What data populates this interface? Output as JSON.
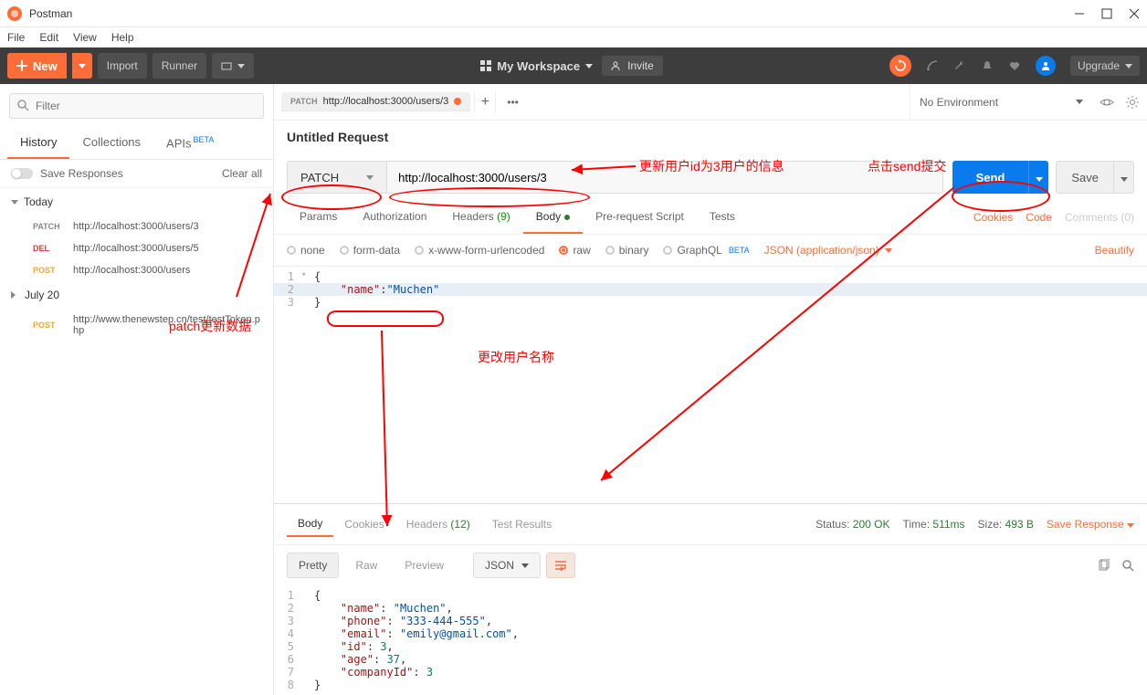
{
  "app": {
    "title": "Postman"
  },
  "menu": [
    "File",
    "Edit",
    "View",
    "Help"
  ],
  "topbar": {
    "new_label": "New",
    "import_label": "Import",
    "runner_label": "Runner",
    "workspace_label": "My Workspace",
    "invite_label": "Invite",
    "upgrade_label": "Upgrade"
  },
  "sidebar": {
    "filter_placeholder": "Filter",
    "tabs": {
      "history": "History",
      "collections": "Collections",
      "apis": "APIs",
      "beta": "BETA"
    },
    "save_responses": "Save Responses",
    "clear_all": "Clear all",
    "groups": [
      {
        "label": "Today",
        "items": [
          {
            "method": "PATCH",
            "cls": "m-patch",
            "url": "http://localhost:3000/users/3"
          },
          {
            "method": "DEL",
            "cls": "m-del",
            "url": "http://localhost:3000/users/5"
          },
          {
            "method": "POST",
            "cls": "m-post",
            "url": "http://localhost:3000/users"
          }
        ]
      },
      {
        "label": "July 20",
        "items": [
          {
            "method": "POST",
            "cls": "m-post",
            "url": "http://www.thenewstep.cn/test/testToken.php"
          }
        ]
      }
    ]
  },
  "annotations": {
    "patch_update": "patch更新数据",
    "update_info": "更新用户id为3用户的信息",
    "click_send": "点击send提交",
    "change_name": "更改用户名称"
  },
  "env": {
    "no_env": "No Environment"
  },
  "tab": {
    "method": "PATCH",
    "url": "http://localhost:3000/users/3"
  },
  "request": {
    "title": "Untitled Request",
    "method": "PATCH",
    "url": "http://localhost:3000/users/3",
    "send": "Send",
    "save": "Save",
    "subtabs": {
      "params": "Params",
      "auth": "Authorization",
      "headers": "Headers",
      "headers_count": "(9)",
      "body": "Body",
      "prereq": "Pre-request Script",
      "tests": "Tests"
    },
    "links": {
      "cookies": "Cookies",
      "code": "Code",
      "comments": "Comments (0)"
    },
    "body_types": {
      "none": "none",
      "formdata": "form-data",
      "urlenc": "x-www-form-urlencoded",
      "raw": "raw",
      "binary": "binary",
      "graphql": "GraphQL",
      "beta": "BETA"
    },
    "content_type": "JSON (application/json)",
    "beautify": "Beautify",
    "body_lines": [
      {
        "n": "1",
        "text": "{",
        "arrow": "▾"
      },
      {
        "n": "2",
        "key": "\"name\"",
        "val": "\"Muchen\""
      },
      {
        "n": "3",
        "text": "}"
      }
    ]
  },
  "response": {
    "tabs": {
      "body": "Body",
      "cookies": "Cookies",
      "headers": "Headers",
      "headers_count": "(12)",
      "tests": "Test Results"
    },
    "status": {
      "label": "Status:",
      "value": "200 OK"
    },
    "time": {
      "label": "Time:",
      "value": "511ms"
    },
    "size": {
      "label": "Size:",
      "value": "493 B"
    },
    "save_response": "Save Response",
    "toolbar": {
      "pretty": "Pretty",
      "raw": "Raw",
      "preview": "Preview",
      "json": "JSON"
    },
    "lines": [
      {
        "n": "1",
        "c": "{"
      },
      {
        "n": "2",
        "i": 1,
        "k": "\"name\"",
        "v": "\"Muchen\"",
        "t": "str",
        "comma": true
      },
      {
        "n": "3",
        "i": 1,
        "k": "\"phone\"",
        "v": "\"333-444-555\"",
        "t": "str",
        "comma": true
      },
      {
        "n": "4",
        "i": 1,
        "k": "\"email\"",
        "v": "\"emily@gmail.com\"",
        "t": "str",
        "comma": true
      },
      {
        "n": "5",
        "i": 1,
        "k": "\"id\"",
        "v": "3",
        "t": "num",
        "comma": true
      },
      {
        "n": "6",
        "i": 1,
        "k": "\"age\"",
        "v": "37",
        "t": "num",
        "comma": true
      },
      {
        "n": "7",
        "i": 1,
        "k": "\"companyId\"",
        "v": "3",
        "t": "num",
        "comma": false
      },
      {
        "n": "8",
        "c": "}"
      }
    ]
  }
}
